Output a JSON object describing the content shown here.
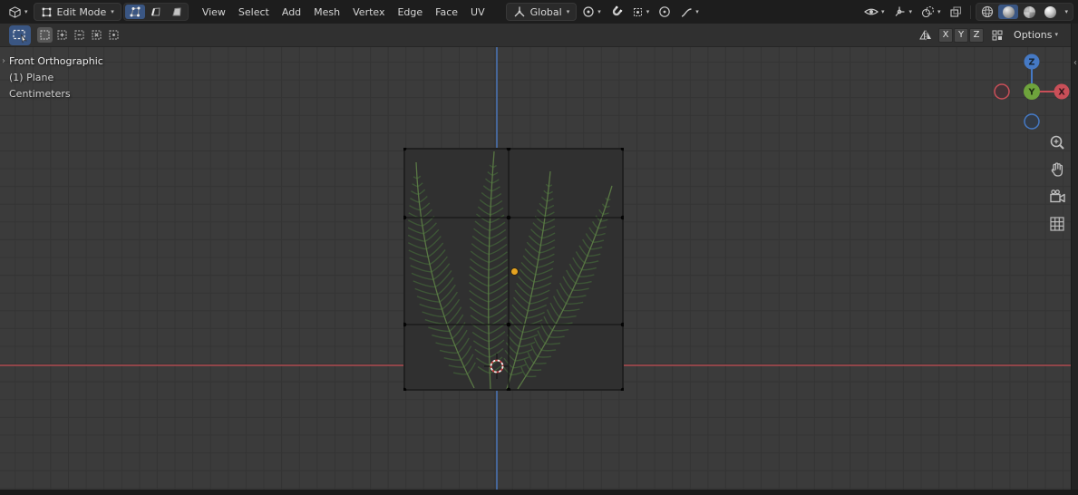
{
  "icons": {
    "caret": "▾",
    "panel_open_left": "›",
    "panel_open_right": "‹"
  },
  "header": {
    "mode": {
      "label": "Edit Mode"
    },
    "menus": [
      {
        "label": "View"
      },
      {
        "label": "Select"
      },
      {
        "label": "Add"
      },
      {
        "label": "Mesh"
      },
      {
        "label": "Vertex"
      },
      {
        "label": "Edge"
      },
      {
        "label": "Face"
      },
      {
        "label": "UV"
      }
    ],
    "orientation": {
      "label": "Global"
    }
  },
  "tool_settings": {
    "mirror_axes": [
      {
        "label": "X"
      },
      {
        "label": "Y"
      },
      {
        "label": "Z"
      }
    ],
    "options": {
      "label": "Options"
    }
  },
  "viewport": {
    "view_label": "Front Orthographic",
    "object_label": "(1) Plane",
    "unit_label": "Centimeters"
  },
  "gizmo": {
    "x_label": "X",
    "y_label": "Y",
    "z_label": "Z"
  },
  "colors": {
    "accent": "#4772b3",
    "accent-dim": "#3a5683",
    "axis-x": "#a84a4f",
    "axis-z": "#4a72b0",
    "gizmo-x": "#c94f58",
    "gizmo-y": "#6ea33c",
    "gizmo-z": "#4579c4",
    "origin": "#e5a320",
    "cursor-red": "#c94343",
    "fern-stem": "#5c7b46",
    "fern-leaf": "#3f5a37"
  }
}
